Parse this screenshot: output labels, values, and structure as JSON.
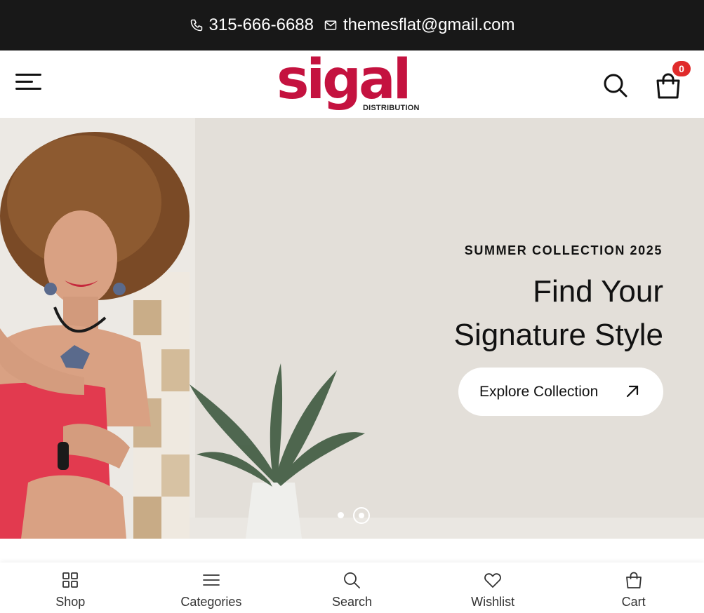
{
  "topbar": {
    "phone": "315-666-6688",
    "email": "themesflat@gmail.com",
    "phone_icon": "phone-icon",
    "email_icon": "mail-icon"
  },
  "header": {
    "logo_text": "sigal",
    "logo_subtext": "DISTRIBUTION",
    "cart_count": "0",
    "brand_color": "#c4123f"
  },
  "hero": {
    "eyebrow": "SUMMER COLLECTION 2025",
    "title_line1": "Find Your",
    "title_line2": "Signature Style",
    "cta_label": "Explore Collection",
    "active_slide": 2,
    "slide_count": 2
  },
  "bottom_nav": {
    "items": [
      {
        "label": "Shop",
        "icon": "grid-icon"
      },
      {
        "label": "Categories",
        "icon": "list-icon"
      },
      {
        "label": "Search",
        "icon": "search-icon"
      },
      {
        "label": "Wishlist",
        "icon": "heart-icon"
      },
      {
        "label": "Cart",
        "icon": "bag-icon"
      }
    ]
  }
}
